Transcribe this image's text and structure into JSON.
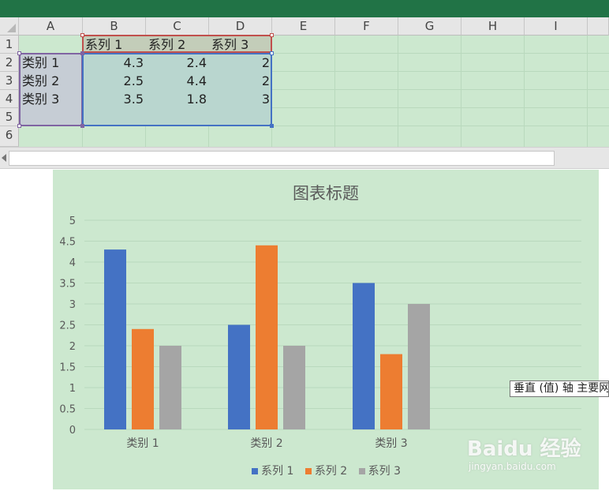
{
  "sheet": {
    "columns": [
      "A",
      "B",
      "C",
      "D",
      "E",
      "F",
      "G",
      "H",
      "I"
    ],
    "rows": [
      "1",
      "2",
      "3",
      "4",
      "5",
      "6"
    ],
    "header_row": [
      "",
      "系列 1",
      "系列 2",
      "系列 3"
    ],
    "data_rows": [
      {
        "category": "类别 1",
        "values": [
          "4.3",
          "2.4",
          "2"
        ]
      },
      {
        "category": "类别 2",
        "values": [
          "2.5",
          "4.4",
          "2"
        ]
      },
      {
        "category": "类别 3",
        "values": [
          "3.5",
          "1.8",
          "3"
        ]
      }
    ]
  },
  "chart": {
    "title": "图表标题",
    "tooltip": "垂直 (值) 轴 主要网格线"
  },
  "chart_data": {
    "type": "bar",
    "title": "图表标题",
    "categories": [
      "类别 1",
      "类别 2",
      "类别 3"
    ],
    "series": [
      {
        "name": "系列 1",
        "values": [
          4.3,
          2.5,
          3.5
        ],
        "color": "#4472c4"
      },
      {
        "name": "系列 2",
        "values": [
          2.4,
          4.4,
          1.8
        ],
        "color": "#ed7d31"
      },
      {
        "name": "系列 3",
        "values": [
          2,
          2,
          3
        ],
        "color": "#a5a5a5"
      }
    ],
    "ylim": [
      0,
      5
    ],
    "yticks": [
      "0",
      "0.5",
      "1",
      "1.5",
      "2",
      "2.5",
      "3",
      "3.5",
      "4",
      "4.5",
      "5"
    ],
    "grid": true,
    "legend_position": "bottom"
  },
  "watermark": {
    "main": "Baidu 经验",
    "sub": "jingyan.baidu.com"
  }
}
